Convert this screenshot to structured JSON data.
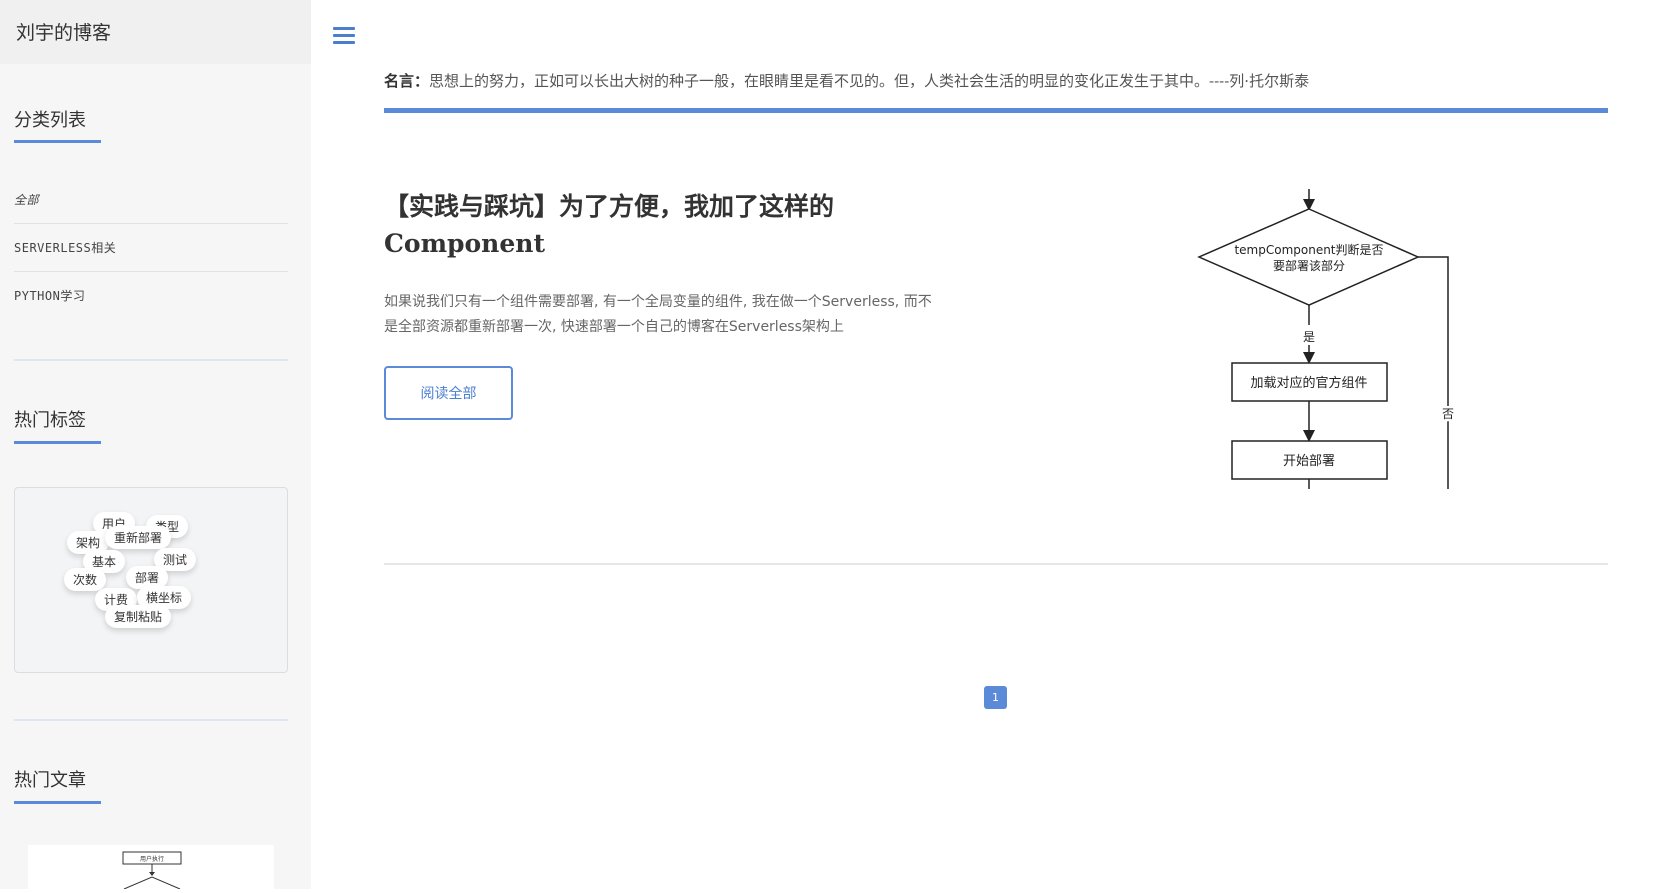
{
  "site": {
    "title": "刘宇的博客"
  },
  "sidebar": {
    "categories_title": "分类列表",
    "categories": [
      "全部",
      "SERVERLESS相关",
      "PYTHON学习"
    ],
    "tags_title": "热门标签",
    "tags": [
      "用户",
      "类型",
      "架构",
      "重新部署",
      "基本",
      "测试",
      "次数",
      "部署",
      "计费",
      "横坐标",
      "复制粘贴"
    ],
    "articles_title": "热门文章",
    "article_thumb_text": "用户执行"
  },
  "header": {
    "quote_label": "名言：",
    "quote_text": "思想上的努力，正如可以长出大树的种子一般，在眼睛里是看不见的。但，人类社会生活的明显的变化正发生于其中。----列·托尔斯泰"
  },
  "post": {
    "title": "【实践与踩坑】为了方便，我加了这样的Component",
    "excerpt": "如果说我们只有一个组件需要部署, 有一个全局变量的组件, 我在做一个Serverless, 而不是全部资源都重新部署一次, 快速部署一个自己的博客在Serverless架构上",
    "read_more": "阅读全部",
    "flowchart": {
      "decision": [
        "tempComponent判断是否",
        "要部署该部分"
      ],
      "yes": "是",
      "no": "否",
      "step1": "加载对应的官方组件",
      "step2": "开始部署"
    }
  },
  "pagination": {
    "current": "1"
  },
  "colors": {
    "accent": "#5b8ad8",
    "sidebar_bg": "#f6f6f7"
  }
}
